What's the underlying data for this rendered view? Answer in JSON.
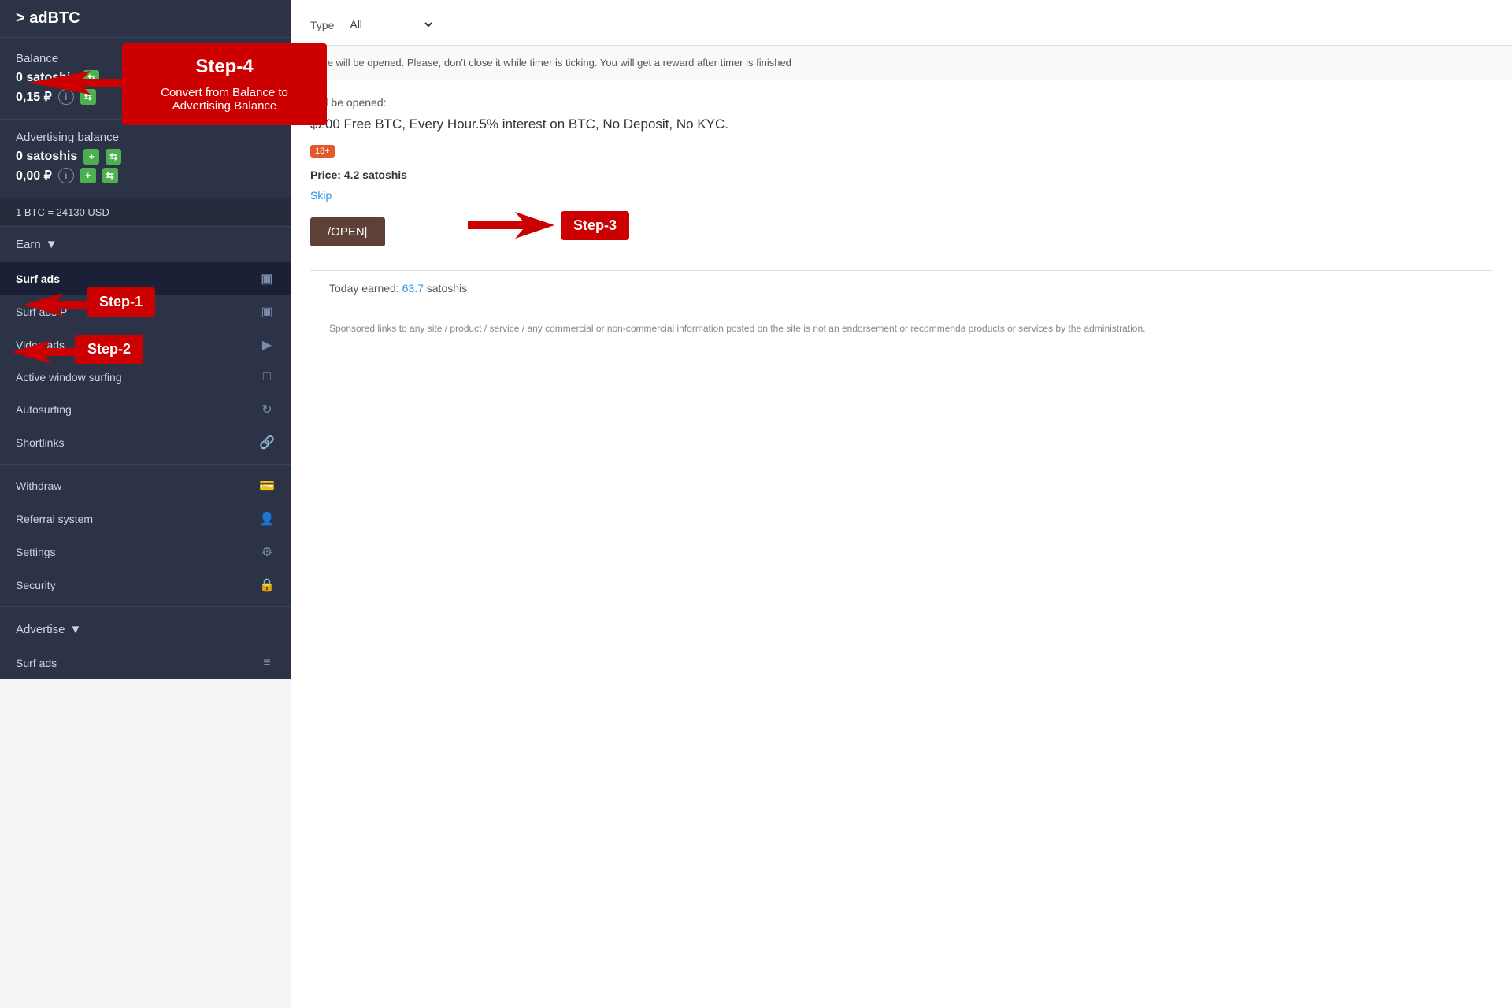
{
  "sidebar": {
    "logo": "adBTC",
    "balance": {
      "label": "Balance",
      "satoshis": "0 satoshis",
      "rubles": "0,15 ₽"
    },
    "advertising_balance": {
      "label": "Advertising balance",
      "satoshis": "0 satoshis",
      "rubles": "0,00 ₽"
    },
    "btc_rate": "1 BTC = 24130 USD",
    "earn_menu": {
      "label": "Earn",
      "items": [
        {
          "label": "Surf ads",
          "active": true,
          "icon": "monitor"
        },
        {
          "label": "Surf ads P",
          "active": false,
          "icon": "monitor"
        },
        {
          "label": "Video ads",
          "active": false,
          "icon": "video"
        },
        {
          "label": "Active window surfing",
          "active": false,
          "icon": "window"
        },
        {
          "label": "Autosurfing",
          "active": false,
          "icon": "refresh"
        },
        {
          "label": "Shortlinks",
          "active": false,
          "icon": "link"
        }
      ]
    },
    "other_items": [
      {
        "label": "Withdraw",
        "icon": "wallet"
      },
      {
        "label": "Referral system",
        "icon": "user"
      },
      {
        "label": "Settings",
        "icon": "gear"
      },
      {
        "label": "Security",
        "icon": "lock"
      }
    ],
    "advertise_menu": {
      "label": "Advertise",
      "items": [
        {
          "label": "Surf ads",
          "icon": "list"
        }
      ]
    }
  },
  "main": {
    "type_label": "Type",
    "info_banner": "page will be opened. Please, don't close it while timer is ticking. You will get a reward after timer is finished",
    "will_be_opened_label": "Will be opened:",
    "ad_title": "$200 Free BTC, Every Hour.5% interest on BTC, No Deposit, No KYC.",
    "age_badge": "18+",
    "price_label": "Price:",
    "price_value": "4.2 satoshis",
    "skip_label": "Skip",
    "open_btn_label": "/OPEN|",
    "today_earned_label": "Today earned:",
    "today_earned_amount": "63.7",
    "today_earned_unit": "satoshis",
    "sponsored_text": "Sponsored links to any site / product / service / any commercial or non-commercial information posted on the site is not an endorsement or recommenda products or services by the administration."
  },
  "annotations": {
    "step1": "Step-1",
    "step2": "Step-2",
    "step3": "Step-3",
    "step4_title": "Step-4",
    "step4_desc": "Convert from Balance to Advertising Balance"
  }
}
